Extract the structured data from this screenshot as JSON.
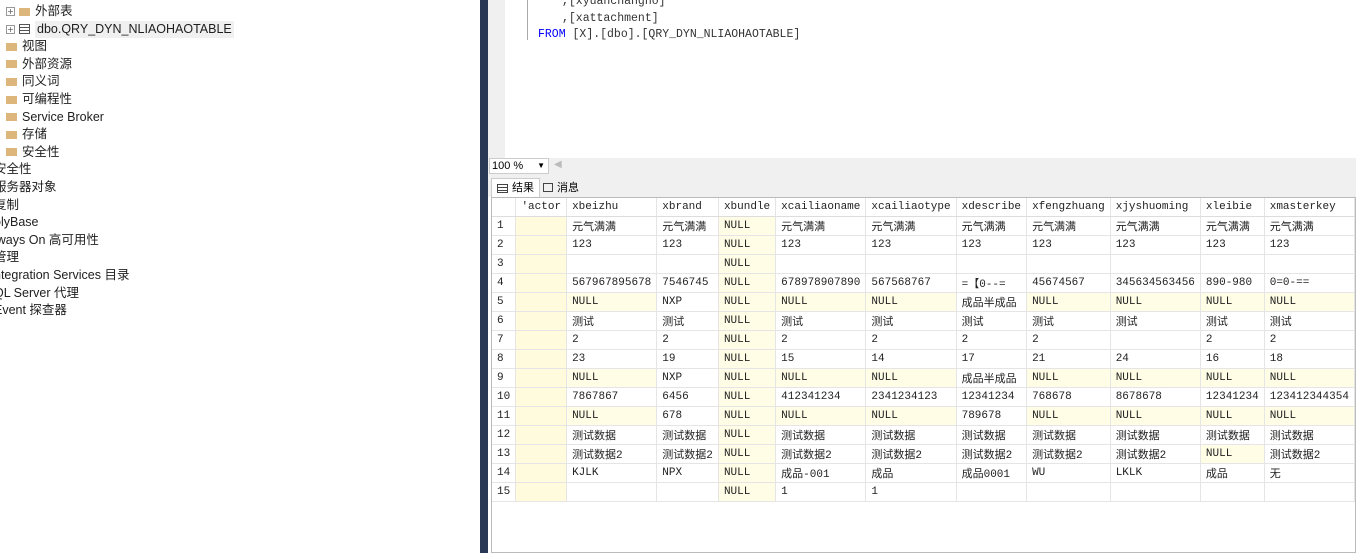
{
  "tree": {
    "items": [
      {
        "label": "外部表",
        "type": "folder",
        "expander": true,
        "indent": 2
      },
      {
        "label": "dbo.QRY_DYN_NLIAOHAOTABLE",
        "type": "table",
        "expander": true,
        "indent": 2,
        "selected": true
      },
      {
        "label": "视图",
        "type": "folder",
        "indent": 1
      },
      {
        "label": "外部资源",
        "type": "folder",
        "indent": 1
      },
      {
        "label": "同义词",
        "type": "folder",
        "indent": 1
      },
      {
        "label": "可编程性",
        "type": "folder",
        "indent": 1
      },
      {
        "label": "Service Broker",
        "type": "folder",
        "indent": 1
      },
      {
        "label": "存储",
        "type": "folder",
        "indent": 1
      },
      {
        "label": "安全性",
        "type": "folder",
        "indent": 1
      },
      {
        "label": "安全性",
        "indent": 0
      },
      {
        "label": "服务器对象",
        "indent": 0
      },
      {
        "label": "复制",
        "indent": 0
      },
      {
        "label": "olyBase",
        "indent": 0
      },
      {
        "label": "lways On 高可用性",
        "indent": 0
      },
      {
        "label": "管理",
        "indent": 0
      },
      {
        "label": "ntegration Services 目录",
        "indent": 0
      },
      {
        "label": "QL Server 代理",
        "indent": 0
      },
      {
        "label": "Event 探查器",
        "indent": 0
      }
    ]
  },
  "editor": {
    "line1": ",[xyuanchangno]",
    "line2": ",[xattachment]",
    "from_kw": "FROM",
    "from_rest": " [X].[dbo].[QRY_DYN_NLIAOHAOTABLE]"
  },
  "zoom": {
    "value": "100 %"
  },
  "tabs": {
    "results": "结果",
    "messages": "消息"
  },
  "grid": {
    "columns": [
      "'actor",
      "xbeizhu",
      "xbrand",
      "xbundle",
      "xcailiaoname",
      "xcailiaotype",
      "xdescribe",
      "xfengzhuang",
      "xjyshuoming",
      "xleibie",
      "xmasterkey"
    ],
    "rows": [
      [
        "1",
        "",
        "元气满满",
        "元气满满",
        "NULL",
        "元气满满",
        "元气满满",
        "元气满满",
        "元气满满",
        "元气满满",
        "元气满满",
        "元气满满"
      ],
      [
        "2",
        "",
        "123",
        "123",
        "NULL",
        "123",
        "123",
        "123",
        "123",
        "123",
        "123",
        "123"
      ],
      [
        "3",
        "",
        "",
        "",
        "NULL",
        "",
        "",
        "",
        "",
        "",
        "",
        ""
      ],
      [
        "4",
        "",
        "567967895678",
        "7546745",
        "NULL",
        "678978907890",
        "567568767",
        "=【0--=",
        "45674567",
        "345634563456",
        "890-980",
        "0=0-=="
      ],
      [
        "5",
        "",
        "NULL",
        "NXP",
        "NULL",
        "NULL",
        "NULL",
        "成品半成品",
        "NULL",
        "NULL",
        "NULL",
        "NULL"
      ],
      [
        "6",
        "",
        "测试",
        "测试",
        "NULL",
        "测试",
        "测试",
        "测试",
        "测试",
        "测试",
        "测试",
        "测试"
      ],
      [
        "7",
        "",
        "2",
        "2",
        "NULL",
        "2",
        "2",
        "2",
        "2",
        "",
        "2",
        "2"
      ],
      [
        "8",
        "",
        "23",
        "19",
        "NULL",
        "15",
        "14",
        "17",
        "21",
        "24",
        "16",
        "18"
      ],
      [
        "9",
        "",
        "NULL",
        "NXP",
        "NULL",
        "NULL",
        "NULL",
        "成品半成品",
        "NULL",
        "NULL",
        "NULL",
        "NULL"
      ],
      [
        "10",
        "",
        "7867867",
        "6456",
        "NULL",
        "412341234",
        "2341234123",
        "12341234",
        "768678",
        "8678678",
        "12341234",
        "123412344354"
      ],
      [
        "11",
        "",
        "NULL",
        "678",
        "NULL",
        "NULL",
        "NULL",
        "789678",
        "NULL",
        "NULL",
        "NULL",
        "NULL"
      ],
      [
        "12",
        "",
        "测试数据",
        "测试数据",
        "NULL",
        "测试数据",
        "测试数据",
        "测试数据",
        "测试数据",
        "测试数据",
        "测试数据",
        "测试数据"
      ],
      [
        "13",
        "",
        "测试数据2",
        "测试数据2",
        "NULL",
        "测试数据2",
        "测试数据2",
        "测试数据2",
        "测试数据2",
        "测试数据2",
        "NULL",
        "测试数据2"
      ],
      [
        "14",
        "",
        "KJLK",
        "NPX",
        "NULL",
        "成品-001",
        "成品",
        "成品0001",
        "WU",
        "LKLK",
        "成品",
        "无"
      ],
      [
        "15",
        "",
        "",
        "",
        "NULL",
        "1",
        "1",
        "",
        "",
        "",
        "",
        ""
      ]
    ]
  }
}
